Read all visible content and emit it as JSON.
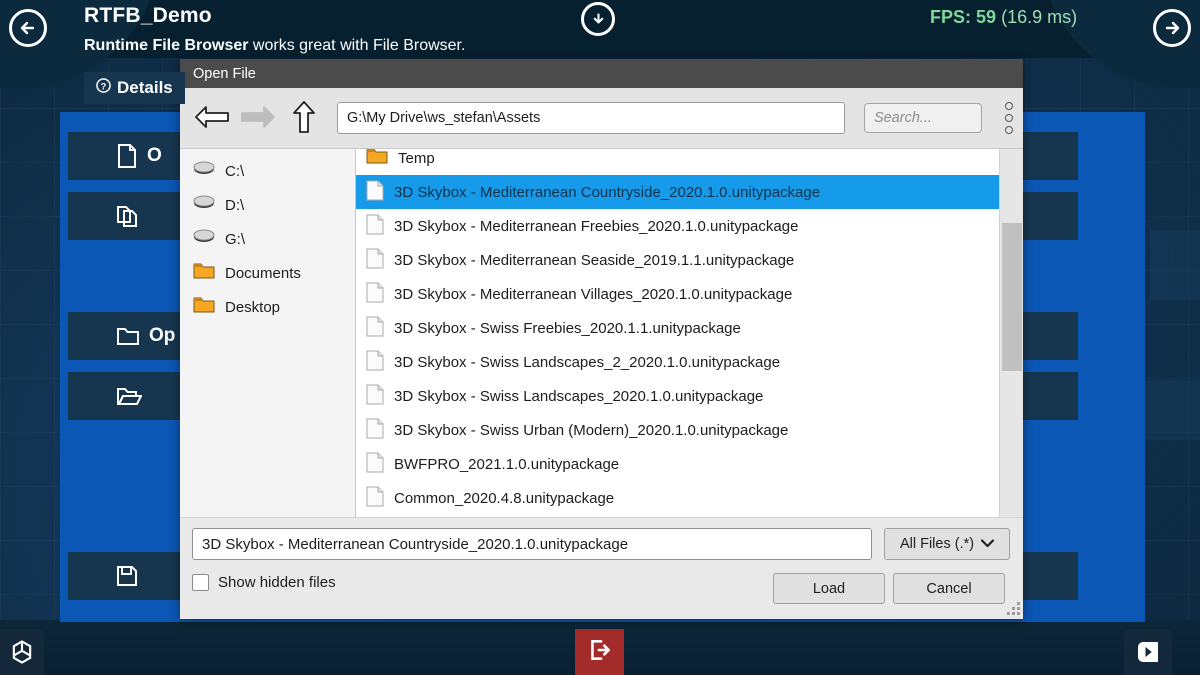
{
  "hud": {
    "prev_icon": "arrow-left-circle-icon",
    "next_icon": "arrow-right-circle-icon",
    "download_icon": "download-circle-icon",
    "app_title": "RTFB_Demo",
    "subtitle_bold": "Runtime File Browser",
    "subtitle_rest": " works great with File Browser.",
    "fps_label": "FPS:",
    "fps_value": "59",
    "fps_ms": "(16.9 ms)",
    "fps_color": "#7fd79a"
  },
  "background_ui": {
    "tab_details": "Details",
    "tab_details_icon": "help-circle-icon",
    "buttons": [
      {
        "label": "O",
        "icon": "file-icon"
      },
      {
        "label": "",
        "icon": "copy-files-icon"
      },
      {
        "label": "Op",
        "icon": "folder-outline-icon"
      },
      {
        "label": "",
        "icon": "folder-open-icon"
      },
      {
        "label": "",
        "icon": "save-icon"
      }
    ],
    "panel_color": "#0b57b5",
    "button_color": "#16364f"
  },
  "taskbar": {
    "unity_logo": "unity-logo-icon",
    "exit_icon": "exit-door-icon",
    "exit_color": "#a32c2a",
    "brand_icon": "crazygames-logo-icon"
  },
  "dialog": {
    "title": "Open File",
    "toolbar": {
      "back_icon": "arrow-left-icon",
      "forward_icon": "arrow-right-icon",
      "up_icon": "arrow-up-icon",
      "path_value": "G:\\My Drive\\ws_stefan\\Assets",
      "search_placeholder": "Search...",
      "menu_icon": "kebab-menu-icon"
    },
    "sidebar": [
      {
        "label": "C:\\",
        "icon": "drive-icon"
      },
      {
        "label": "D:\\",
        "icon": "drive-icon"
      },
      {
        "label": "G:\\",
        "icon": "drive-icon"
      },
      {
        "label": "Documents",
        "icon": "folder-icon"
      },
      {
        "label": "Desktop",
        "icon": "folder-icon"
      }
    ],
    "files": [
      {
        "name": "Temp",
        "icon": "folder-icon",
        "selected": false
      },
      {
        "name": "3D Skybox - Mediterranean Countryside_2020.1.0.unitypackage",
        "icon": "file-icon",
        "selected": true
      },
      {
        "name": "3D Skybox - Mediterranean Freebies_2020.1.0.unitypackage",
        "icon": "file-icon",
        "selected": false
      },
      {
        "name": "3D Skybox - Mediterranean Seaside_2019.1.1.unitypackage",
        "icon": "file-icon",
        "selected": false
      },
      {
        "name": "3D Skybox - Mediterranean Villages_2020.1.0.unitypackage",
        "icon": "file-icon",
        "selected": false
      },
      {
        "name": "3D Skybox - Swiss Freebies_2020.1.1.unitypackage",
        "icon": "file-icon",
        "selected": false
      },
      {
        "name": "3D Skybox - Swiss Landscapes_2_2020.1.0.unitypackage",
        "icon": "file-icon",
        "selected": false
      },
      {
        "name": "3D Skybox - Swiss Landscapes_2020.1.0.unitypackage",
        "icon": "file-icon",
        "selected": false
      },
      {
        "name": "3D Skybox - Swiss Urban (Modern)_2020.1.0.unitypackage",
        "icon": "file-icon",
        "selected": false
      },
      {
        "name": "BWFPRO_2021.1.0.unitypackage",
        "icon": "file-icon",
        "selected": false
      },
      {
        "name": "Common_2020.4.8.unitypackage",
        "icon": "file-icon",
        "selected": false
      }
    ],
    "selection_color": "#169bea",
    "footer": {
      "file_name": "3D Skybox - Mediterranean Countryside_2020.1.0.unitypackage",
      "filter_value": "All Files (.*)",
      "filter_caret_icon": "chevron-down-icon",
      "show_hidden_label": "Show hidden files",
      "show_hidden_checked": false,
      "load_label": "Load",
      "cancel_label": "Cancel",
      "resize_grip_icon": "resize-grip-icon"
    }
  }
}
